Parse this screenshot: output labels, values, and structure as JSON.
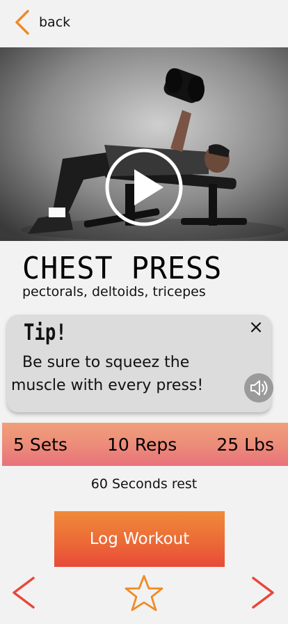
{
  "header": {
    "back_label": "back"
  },
  "exercise": {
    "name": "CHEST PRESS",
    "muscles": "pectorals, deltoids, tricepes"
  },
  "tip": {
    "title": "Tip!",
    "text_line1": "Be sure to squeez the",
    "text_line2": "muscle with every press!",
    "close_icon": "×"
  },
  "stats": {
    "sets": "5 Sets",
    "reps": "10 Reps",
    "weight": "25 Lbs"
  },
  "rest": "60 Seconds rest",
  "actions": {
    "log_label": "Log Workout"
  },
  "colors": {
    "accent": "#f08a24",
    "nav_red": "#e8473a"
  }
}
